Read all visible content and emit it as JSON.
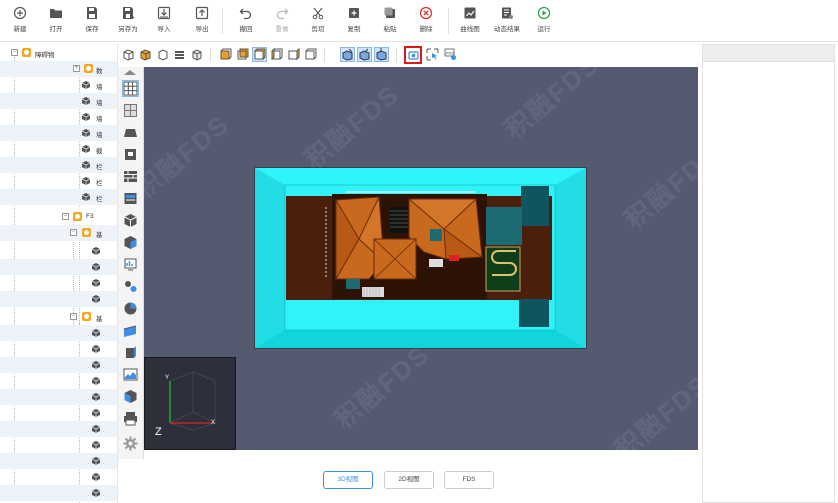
{
  "toolbar": {
    "items": [
      {
        "label": "新建",
        "icon": "plus-circle-icon"
      },
      {
        "label": "打开",
        "icon": "folder-open-icon"
      },
      {
        "label": "保存",
        "icon": "save-icon"
      },
      {
        "label": "另存为",
        "icon": "save-as-icon"
      },
      {
        "label": "导入",
        "icon": "import-icon"
      },
      {
        "label": "导出",
        "icon": "export-icon"
      },
      {
        "label": "撤回",
        "icon": "undo-icon"
      },
      {
        "label": "重做",
        "icon": "redo-icon"
      },
      {
        "label": "剪切",
        "icon": "scissors-icon"
      },
      {
        "label": "复制",
        "icon": "copy-icon"
      },
      {
        "label": "粘贴",
        "icon": "paste-icon"
      },
      {
        "label": "删除",
        "icon": "delete-icon"
      },
      {
        "label": "曲线图",
        "icon": "chart-icon"
      },
      {
        "label": "动态结果",
        "icon": "results-icon"
      },
      {
        "label": "运行",
        "icon": "run-icon"
      }
    ]
  },
  "tree": {
    "root_label": "障碍物",
    "items": [
      {
        "label": "数"
      },
      {
        "label": "墙"
      },
      {
        "label": "墙"
      },
      {
        "label": "墙"
      },
      {
        "label": "墙"
      },
      {
        "label": "截"
      },
      {
        "label": "栏"
      },
      {
        "label": "栏"
      },
      {
        "label": "栏"
      },
      {
        "label": "F3"
      },
      {
        "label": "基"
      },
      {
        "label": "基"
      }
    ]
  },
  "tabs": {
    "view3d": "3D视图",
    "view2d": "2D视图",
    "fds": "FDS"
  },
  "viewport": {
    "watermark": "积融FDS",
    "axis_y": "Y",
    "axis_x": "X",
    "axis_z": "Z"
  },
  "viewbar": {
    "fds_icon_text": "FDS"
  },
  "colors": {
    "viewport_bg": "#545b71",
    "floor_cyan": "#19e8f0",
    "roof_orange": "#c8691e",
    "accent_blue": "#3d8ee8",
    "highlight_red": "#e01818"
  }
}
